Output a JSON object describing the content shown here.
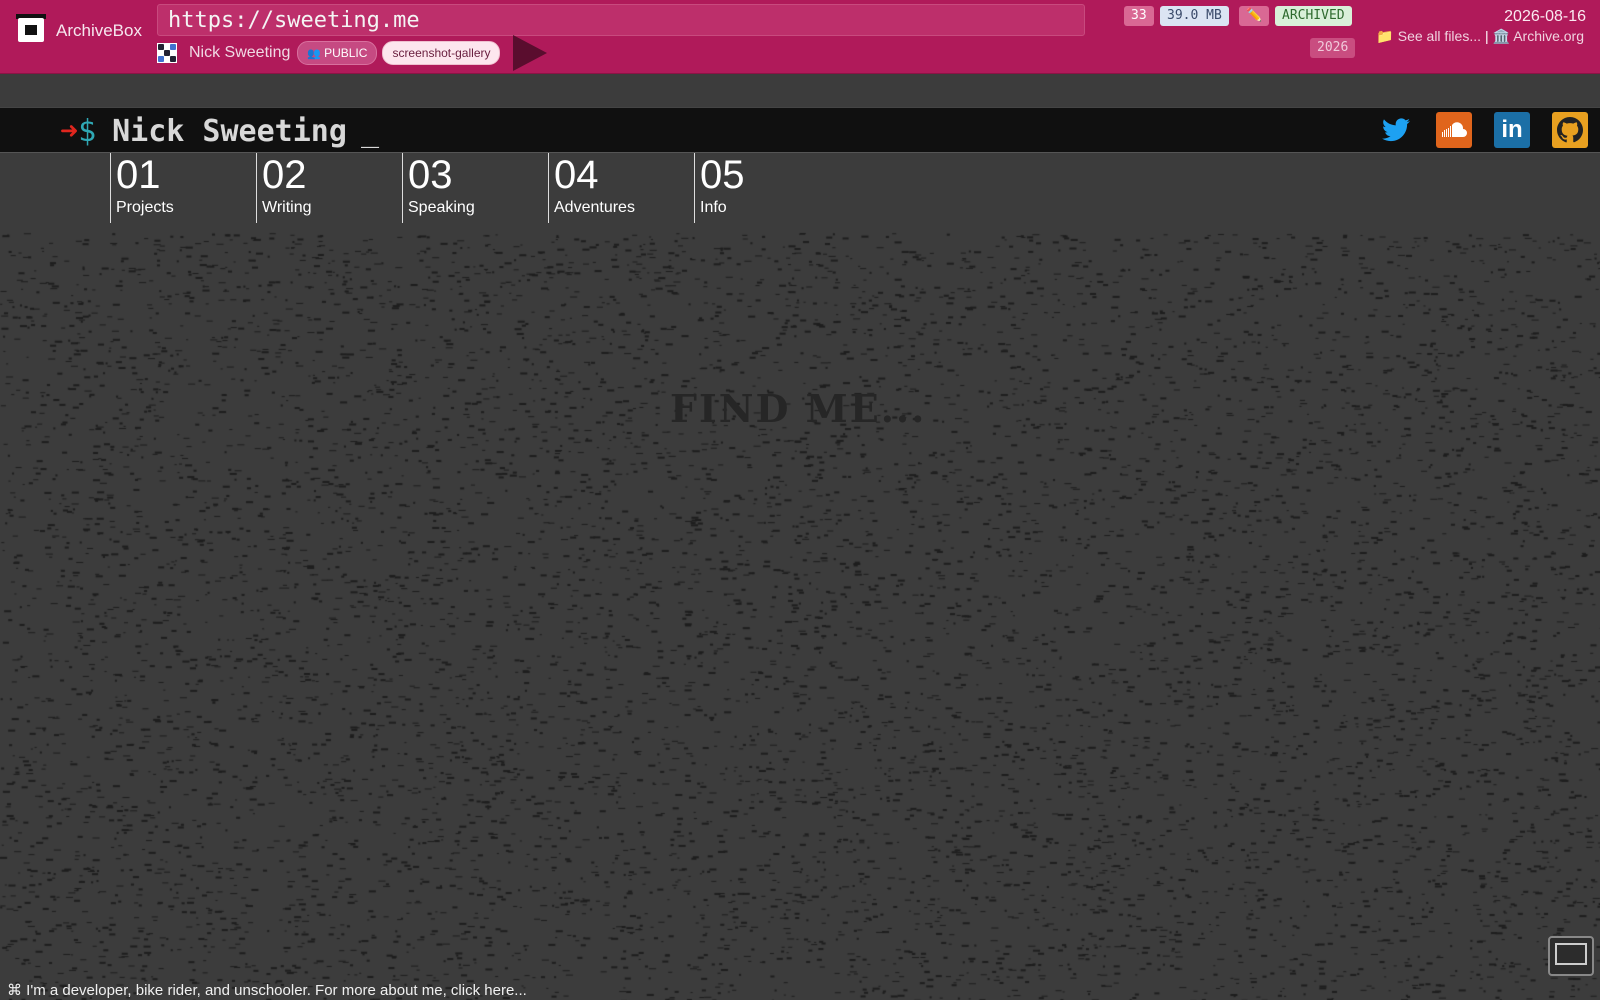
{
  "archivebox": {
    "brand": "ArchiveBox",
    "url": "https://sweeting.me",
    "title": "Nick Sweeting",
    "public_label": "PUBLIC",
    "tag": "screenshot-gallery",
    "count": "33",
    "size": "39.0 MB",
    "edit_icon": "pencil-icon",
    "status": "ARCHIVED",
    "year": "2026",
    "date": "2026-08-16",
    "see_all": "📁 See all files...",
    "separator": "|",
    "archive_org": "🏛️ Archive.org",
    "colors": {
      "header": "#b01a5a"
    }
  },
  "site": {
    "prompt_arrow": "➜",
    "prompt_dollar": "$",
    "prompt_name": "Nick Sweeting",
    "prompt_cursor": "_",
    "social": [
      "twitter-icon",
      "soundcloud-icon",
      "linkedin-icon",
      "github-icon"
    ],
    "linkedin_text": "in",
    "nav": [
      {
        "num": "01",
        "label": "Projects"
      },
      {
        "num": "02",
        "label": "Writing"
      },
      {
        "num": "03",
        "label": "Speaking"
      },
      {
        "num": "04",
        "label": "Adventures"
      },
      {
        "num": "05",
        "label": "Info"
      }
    ],
    "center_text": "FIND ME...",
    "footer": "⌘ I'm a developer, bike rider, and unschooler. For more about me, click here..."
  }
}
